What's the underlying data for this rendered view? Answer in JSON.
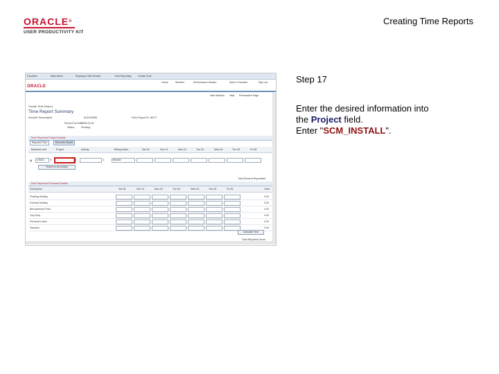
{
  "header": {
    "brand": "ORACLE",
    "kit": "USER PRODUCTIVITY KIT",
    "doc_title": "Creating Time Reports"
  },
  "instructions": {
    "step": "Step 17",
    "line1": "Enter the desired information into",
    "line2_pre": "the ",
    "line2_field": "Project",
    "line2_post": " field.",
    "line3_pre": "Enter \"",
    "line3_value": "SCM_INSTALL",
    "line3_post": "\"."
  },
  "screenshot": {
    "breadcrumb": [
      "Favorites",
      "Main Menu",
      "Employee Self-Service",
      "Time Reporting",
      "Create Time"
    ],
    "nav_links": [
      "Home",
      "Worklist",
      "Performance Monitor",
      "Add to Favorites",
      "Sign out"
    ],
    "brand": "ORACLE",
    "utility_links": [
      "New Window",
      "Help",
      "Personalize Page"
    ],
    "crumb_small": "Create Time Report",
    "page_title": "Time Report Summary",
    "employee_name": "Kenneth Schumacher",
    "employee_id": "KU0100085",
    "report_status": "*Time Report ID: NEXT",
    "period_label": "Period End Date",
    "period_value": "2005-03-05",
    "status_label": "Status",
    "status_value": "Pending",
    "section1": "Time Reported Project Details",
    "tabs": [
      "Reported Time",
      "Elements Details"
    ],
    "grid_headers": [
      "Business Unit",
      "Project",
      "Activity",
      "Billing Action",
      "Sat 28",
      "Sun 01",
      "Mon 02",
      "Tue 03",
      "Wed 04",
      "Thu 05",
      "Fri 06"
    ],
    "row_unit": "US001",
    "row_billing": "Billable",
    "add_button": "Report on an Activity",
    "totals_link": "Total Element Reportable",
    "section2": "Time Reported Personal Details",
    "grid2_headers": [
      "Description",
      "Sat 28",
      "Sun 01",
      "Mon 02",
      "Tue 03",
      "Wed 04",
      "Thu 05",
      "Fri 06",
      "Total"
    ],
    "grid2_rows": [
      {
        "label": "Floating Holiday",
        "total": "0.00"
      },
      {
        "label": "General Holiday",
        "total": "0.00"
      },
      {
        "label": "Bereavement Paid",
        "total": "0.00"
      },
      {
        "label": "Jury Duty",
        "total": "0.00"
      },
      {
        "label": "Personal Leave",
        "total": "0.00"
      },
      {
        "label": "Vacation",
        "total": "0.00"
      }
    ],
    "calc_button": "Calculate Time",
    "total_label": "Total Reported Hours"
  }
}
